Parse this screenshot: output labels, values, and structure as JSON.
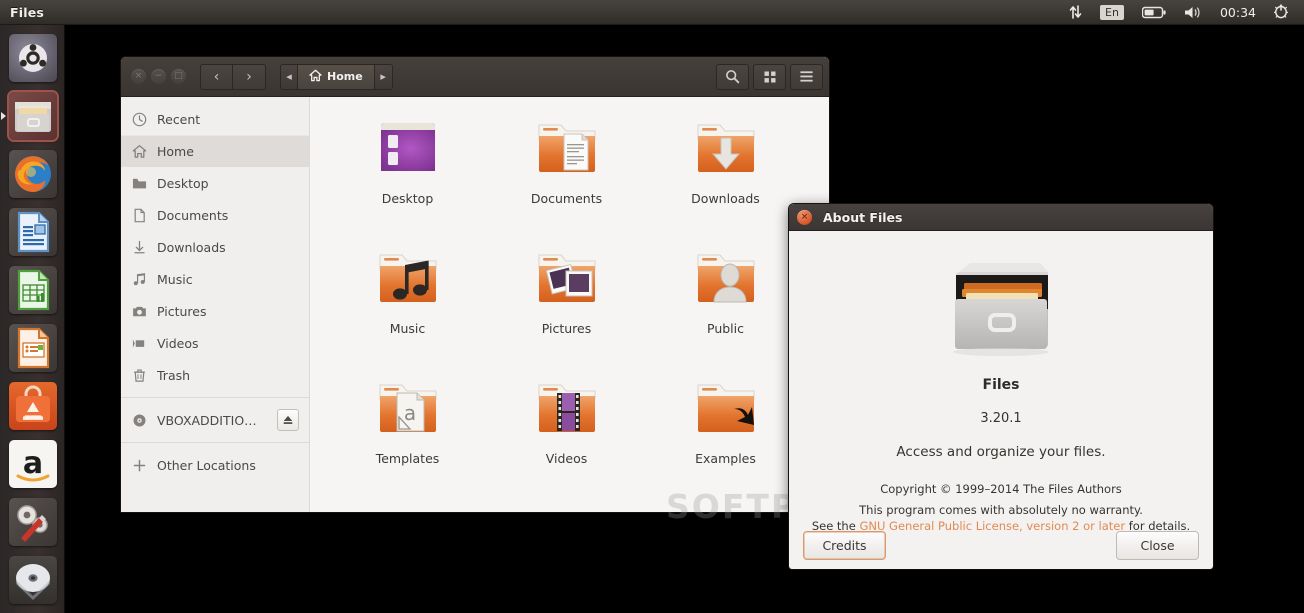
{
  "panel": {
    "app_title": "Files",
    "indicators": [
      {
        "name": "network-icon",
        "glyph": "⇅"
      },
      {
        "name": "keyboard-layout-indicator",
        "label": "En"
      },
      {
        "name": "battery-icon",
        "glyph": "battery"
      },
      {
        "name": "volume-icon",
        "glyph": "🔊"
      }
    ],
    "clock": "00:34",
    "session_menu_icon": "gear-power-icon"
  },
  "launcher": {
    "items": [
      {
        "name": "ubuntu-dash-home",
        "label": "Dash Home",
        "running": false
      },
      {
        "name": "files-manager",
        "label": "Files",
        "running": true
      },
      {
        "name": "firefox",
        "label": "Firefox Web Browser",
        "running": false
      },
      {
        "name": "libreoffice-writer",
        "label": "LibreOffice Writer",
        "running": false
      },
      {
        "name": "libreoffice-calc",
        "label": "LibreOffice Calc",
        "running": false
      },
      {
        "name": "libreoffice-impress",
        "label": "LibreOffice Impress",
        "running": false
      },
      {
        "name": "ubuntu-software-center",
        "label": "Ubuntu Software Center",
        "running": false
      },
      {
        "name": "amazon",
        "label": "Amazon",
        "running": false
      },
      {
        "name": "system-settings",
        "label": "System Settings",
        "running": false
      },
      {
        "name": "cd-drive",
        "label": "VBOXADDITIONS",
        "running": false
      }
    ]
  },
  "files_window": {
    "window_controls": [
      {
        "name": "close-button",
        "glyph": "×"
      },
      {
        "name": "minimize-button",
        "glyph": "−"
      },
      {
        "name": "maximize-button",
        "glyph": "□"
      }
    ],
    "nav": {
      "back_label": "‹",
      "forward_label": "›"
    },
    "pathbar": {
      "prev_arrow": "◂",
      "current": "Home",
      "next_arrow": "▸"
    },
    "toolbar": {
      "search_label": "Search",
      "view_label": "View options",
      "menu_label": "Menu"
    },
    "sidebar": {
      "items": [
        {
          "label": "Recent",
          "icon": "clock-icon",
          "selected": false
        },
        {
          "label": "Home",
          "icon": "home-icon",
          "selected": true
        },
        {
          "label": "Desktop",
          "icon": "desktop-folder-icon",
          "selected": false
        },
        {
          "label": "Documents",
          "icon": "document-icon",
          "selected": false
        },
        {
          "label": "Downloads",
          "icon": "download-icon",
          "selected": false
        },
        {
          "label": "Music",
          "icon": "music-note-icon",
          "selected": false
        },
        {
          "label": "Pictures",
          "icon": "camera-icon",
          "selected": false
        },
        {
          "label": "Videos",
          "icon": "video-icon",
          "selected": false
        },
        {
          "label": "Trash",
          "icon": "trash-icon",
          "selected": false
        }
      ],
      "devices": [
        {
          "label": "VBOXADDITIO…",
          "icon": "disc-icon",
          "eject": true
        }
      ],
      "other": {
        "label": "Other Locations",
        "icon": "plus-icon"
      }
    },
    "files": [
      {
        "label": "Desktop",
        "icon": "desktop-folder"
      },
      {
        "label": "Documents",
        "icon": "documents-folder"
      },
      {
        "label": "Downloads",
        "icon": "downloads-folder"
      },
      {
        "label": "Music",
        "icon": "music-folder"
      },
      {
        "label": "Pictures",
        "icon": "pictures-folder"
      },
      {
        "label": "Public",
        "icon": "public-folder"
      },
      {
        "label": "Templates",
        "icon": "templates-folder"
      },
      {
        "label": "Videos",
        "icon": "videos-folder"
      },
      {
        "label": "Examples",
        "icon": "examples-folder"
      }
    ]
  },
  "about_dialog": {
    "title": "About Files",
    "close_glyph": "×",
    "app_icon": "file-cabinet-icon",
    "app_name": "Files",
    "version": "3.20.1",
    "comment": "Access and organize your files.",
    "copyright": "Copyright © 1999–2014 The Files Authors",
    "license_line1": "This program comes with absolutely no warranty.",
    "license_prefix": "See the ",
    "license_link": "GNU General Public License, version 2 or later",
    "license_suffix": " for details.",
    "credits_label": "Credits",
    "close_label": "Close"
  },
  "watermark": "SOFTPEDIA",
  "colors": {
    "accent_orange": "#dd4814",
    "panel_bg": "#3c3833",
    "window_chrome": "#413c38",
    "sidebar_bg": "#f1efed",
    "content_bg": "#f6f5f4",
    "link": "#e08a52"
  }
}
